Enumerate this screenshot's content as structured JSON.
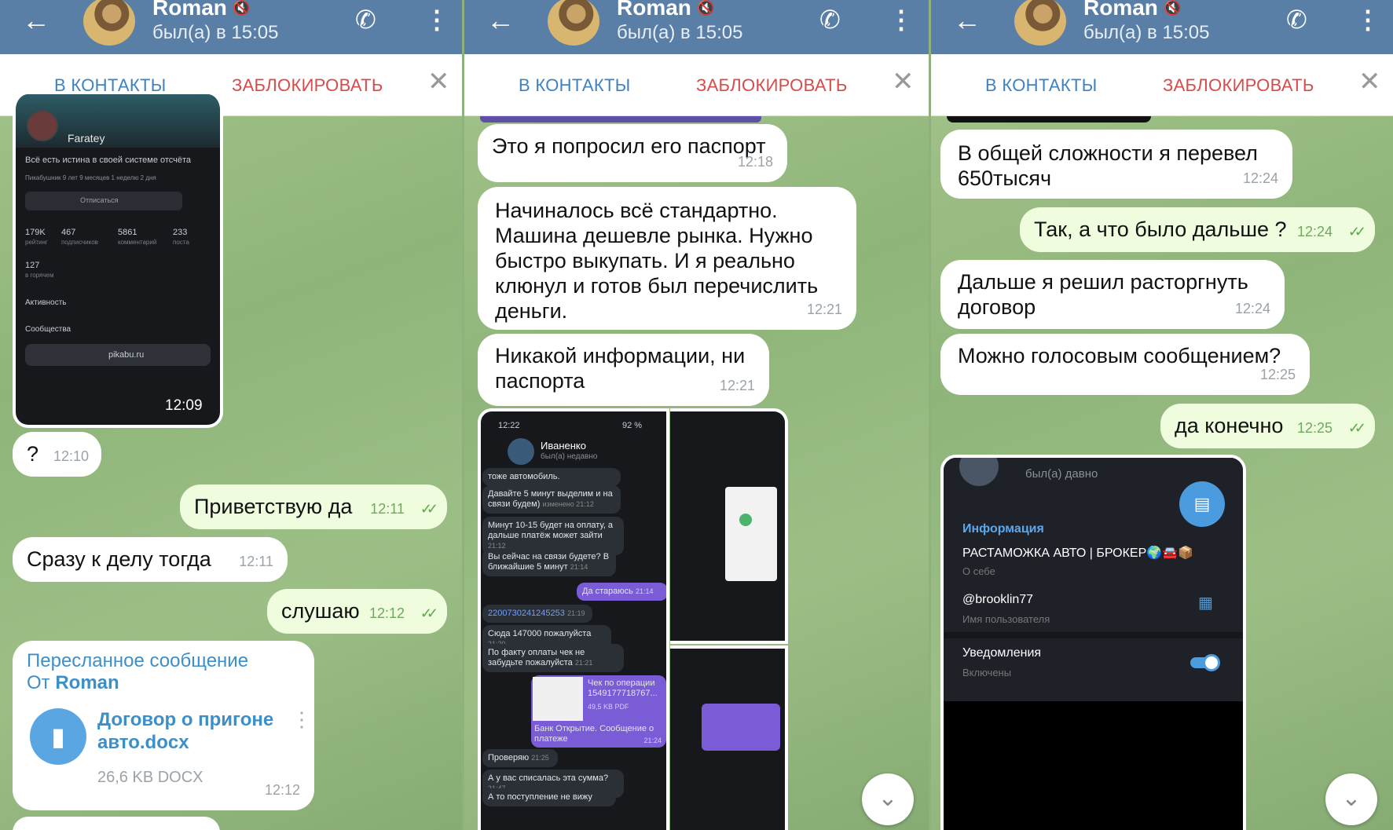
{
  "header": {
    "name": "Roman",
    "status": "был(а) в 15:05"
  },
  "actions": {
    "add": "В КОНТАКТЫ",
    "block": "ЗАБЛОКИРОВАТЬ"
  },
  "icons": {
    "back": "arrow-left-icon",
    "mute": "muted-icon",
    "call": "phone-icon",
    "menu": "more-vertical-icon",
    "close": "close-icon",
    "scroll": "chevron-down-icon"
  },
  "panel1": {
    "screenshot": {
      "profile": "Faratey",
      "motto": "Всё есть истина в своей системе отсчёта",
      "since": "Пикабушник 9 лет 9 месяцев 1 неделю 2 дня",
      "unsubscribe": "Отписаться",
      "rating": "179K",
      "rating_l": "рейтинг",
      "subs": "467",
      "subs_l": "подписчиков",
      "comments": "5861",
      "comments_l": "комментарий",
      "posts": "233",
      "posts_l": "поста",
      "hot": "127",
      "hot_l": "в горячем",
      "activity": "Активность",
      "communities": "Сообщества",
      "url": "pikabu.ru",
      "time": "12:09"
    },
    "m1": {
      "text": "?",
      "time": "12:10"
    },
    "m2": {
      "text": "Приветствую да",
      "time": "12:11"
    },
    "m3": {
      "text": "Сразу к делу тогда",
      "time": "12:11"
    },
    "m4": {
      "text": "слушаю",
      "time": "12:12"
    },
    "fwd": {
      "title": "Пересланное сообщение",
      "from_prefix": "От ",
      "from": "Roman",
      "file": "Договор о пригоне авто.docx",
      "size": "26,6 KB DOCX",
      "time": "12:12"
    }
  },
  "panel2": {
    "m1": {
      "text": "Это я попросил его паспорт",
      "time": "12:18"
    },
    "m2": {
      "text": "Начиналось всё стандартно. Машина дешевле рынка. Нужно быстро выкупать. И я реально клюнул и готов был перечислить деньги.",
      "time": "12:21"
    },
    "m3": {
      "text": "Никакой информации, ни паспорта",
      "time": "12:21"
    },
    "shot": {
      "clock": "12:22",
      "battery": "92 %",
      "contact": "Иваненко",
      "contact_status": "был(а) недавно",
      "c1": "тоже автомобиль.",
      "c2": "Давайте 5 минут выделим и на связи будем)",
      "c2t": "изменено 21:12",
      "c3": "Минут 10-15 будет на оплату, а дальше платёж может зайти",
      "c3t": "21:12",
      "c4": "Вы сейчас на связи будете? В ближайшие 5 минут",
      "c4t": "21:14",
      "c5": "Да стараюсь",
      "c5t": "21:14",
      "c6": "2200730241245253",
      "c6t": "21:19",
      "c7": "Сюда 147000 пожалуйста",
      "c7t": "21:20",
      "c8": "По факту оплаты чек не забудьте пожалуйста",
      "c8t": "21:21",
      "c9": "Чек по операции 1549177718767...",
      "c9s": "49,5 KB PDF",
      "c9c": "Банк Открытие. Сообщение о платеже",
      "c9t": "21:24",
      "c10": "Проверяю",
      "c10t": "21:25",
      "c11": "А у вас списалась эта сумма?",
      "c11t": "21:47",
      "c12": "А то поступление не вижу"
    }
  },
  "panel3": {
    "m1": {
      "text": "В общей сложности я перевел 650тысяч",
      "time": "12:24"
    },
    "m2": {
      "text": "Так, а что было дальше ?",
      "time": "12:24"
    },
    "m3": {
      "text": "Дальше я решил расторгнуть договор",
      "time": "12:24"
    },
    "m4": {
      "text": "Можно голосовым сообщением?",
      "time": "12:25"
    },
    "m5": {
      "text": "да конечно",
      "time": "12:25"
    },
    "shot": {
      "status": "был(а) давно",
      "info": "Информация",
      "bio": "РАСТАМОЖКА АВТО | БРОКЕР🌍🚘📦",
      "bio_l": "О себе",
      "username": "@brooklin77",
      "username_l": "Имя пользователя",
      "notif": "Уведомления",
      "notif_l": "Включены"
    }
  }
}
